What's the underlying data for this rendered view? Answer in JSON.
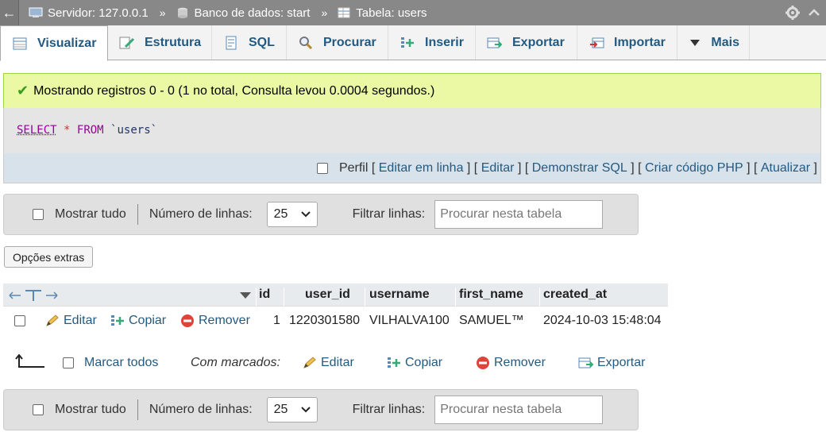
{
  "breadcrumb": {
    "back_icon": "left-arrow",
    "server": "Servidor: 127.0.0.1",
    "database": "Banco de dados: start",
    "table": "Tabela: users",
    "separator": "»"
  },
  "tabs": [
    {
      "label": "Visualizar",
      "icon": "browse-icon",
      "active": true
    },
    {
      "label": "Estrutura",
      "icon": "structure-icon"
    },
    {
      "label": "SQL",
      "icon": "sql-icon"
    },
    {
      "label": "Procurar",
      "icon": "search-icon"
    },
    {
      "label": "Inserir",
      "icon": "insert-icon"
    },
    {
      "label": "Exportar",
      "icon": "export-icon"
    },
    {
      "label": "Importar",
      "icon": "import-icon"
    },
    {
      "label": "Mais",
      "icon": "caret-down-icon"
    }
  ],
  "message": {
    "text": "Mostrando registros 0 - 0 (1 no total, Consulta levou 0.0004 segundos.)",
    "success_color": "#ebf8a4"
  },
  "query": {
    "select": "SELECT",
    "star": "*",
    "from": "FROM",
    "table": "`users`"
  },
  "tools": {
    "profile_label": "Perfil",
    "edit_inline": "Editar em linha",
    "edit": "Editar",
    "explain": "Demonstrar SQL",
    "create_php": "Criar código PHP",
    "refresh": "Atualizar"
  },
  "nav": {
    "show_all": "Mostrar tudo",
    "rows_label": "Número de linhas:",
    "rows_value": "25",
    "filter_label": "Filtrar linhas:",
    "filter_placeholder": "Procurar nesta tabela"
  },
  "extras_button": "Opções extras",
  "table": {
    "columns": [
      "id",
      "user_id",
      "username",
      "first_name",
      "created_at"
    ],
    "rows": [
      {
        "edit": "Editar",
        "copy": "Copiar",
        "delete": "Remover",
        "cells": [
          "1",
          "1220301580",
          "VILHALVA100",
          "SAMUEL™",
          "2024-10-03 15:48:04"
        ]
      }
    ]
  },
  "bulk": {
    "check_all": "Marcar todos",
    "with_selected": "Com marcados:",
    "edit": "Editar",
    "copy": "Copiar",
    "delete": "Remover",
    "export": "Exportar"
  },
  "colors": {
    "link": "#235a81",
    "topbar": "#888888",
    "header_bg": "#e8ebee"
  }
}
